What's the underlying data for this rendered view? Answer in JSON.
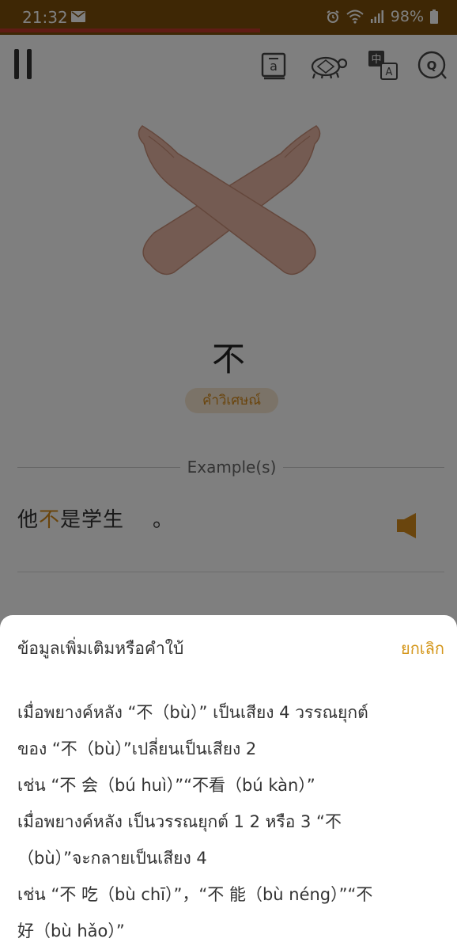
{
  "status": {
    "time": "21:32",
    "battery": "98%"
  },
  "lesson": {
    "progress": 0.57
  },
  "icons": {
    "pause": "pause-icon",
    "transcription": "pinyin-toggle-icon",
    "slow": "turtle-icon",
    "translate": "translate-icon",
    "quiz": "quiz-icon",
    "audio": "speaker-icon"
  },
  "word": {
    "hanzi": "不",
    "part_of_speech": "คำวิเศษณ์"
  },
  "example": {
    "heading": "Example(s)",
    "sentence_before": "他",
    "sentence_highlight": "不",
    "sentence_after": "是学生",
    "sentence_end": "。"
  },
  "sheet": {
    "title": "ข้อมูลเพิ่มเติมหรือคำใบ้",
    "cancel": "ยกเลิก",
    "lines": [
      "เมื่อพยางค์หลัง “不（bù）” เป็นเสียง 4 วรรณยุกต์",
      "ของ “不（bù）”เปลี่ยนเป็นเสียง 2",
      "เช่น “不 会（bú huì）”“不看（bú kàn）”",
      "เมื่อพยางค์หลัง เป็นวรรณยุกต์ 1 2 หรือ 3 “不",
      "（bù）”จะกลายเป็นเสียง 4",
      "เช่น “不 吃（bù chī）”，“不 能（bù néng）”“不",
      "好（bù hǎo）”"
    ]
  },
  "colors": {
    "status_bar": "#7c4e0a",
    "accent": "#d48a1a",
    "progress": "#c0392b"
  }
}
